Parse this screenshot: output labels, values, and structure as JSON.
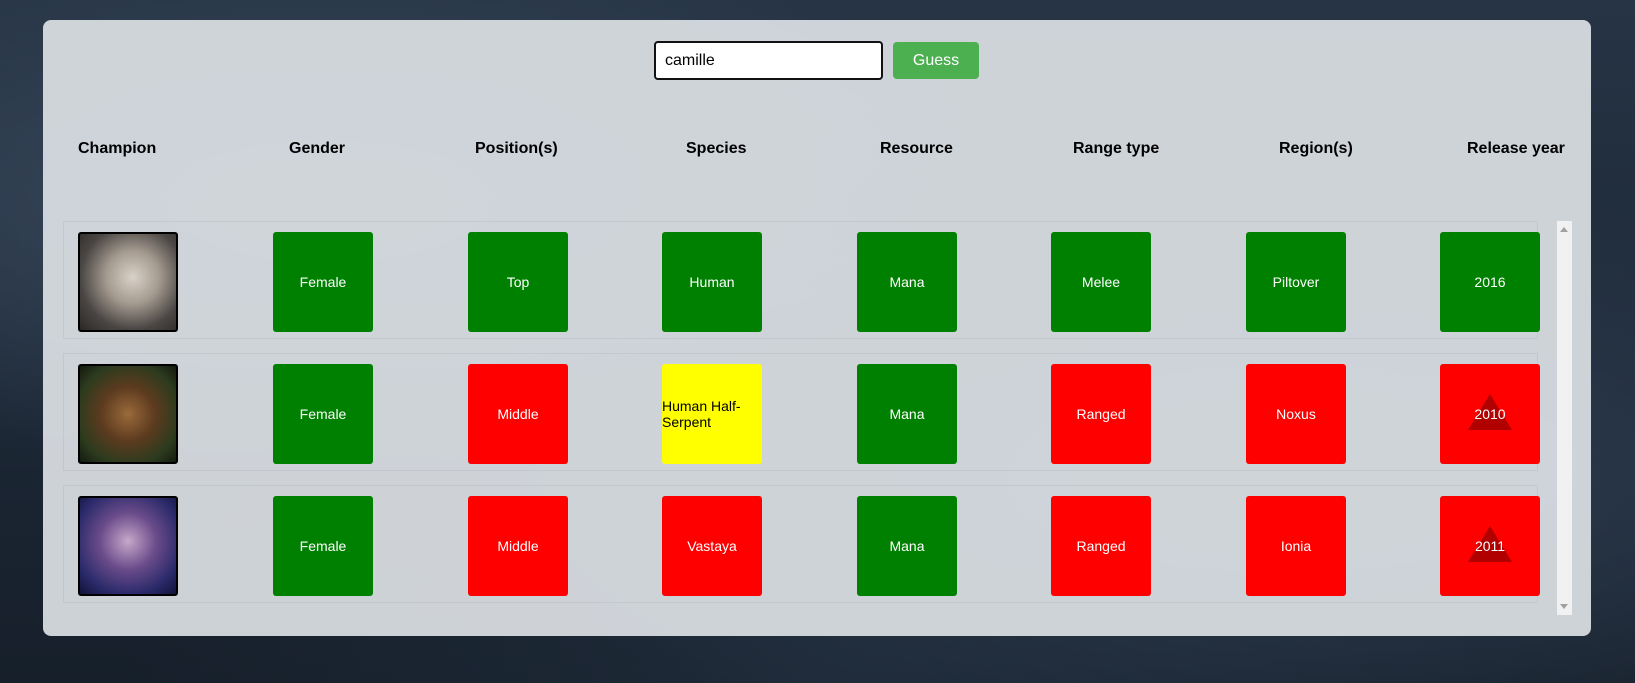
{
  "search": {
    "value": "camille",
    "button_label": "Guess"
  },
  "headers": [
    "Champion",
    "Gender",
    "Position(s)",
    "Species",
    "Resource",
    "Range type",
    "Region(s)",
    "Release year"
  ],
  "colors": {
    "correct": "#008000",
    "partial": "#ffff00",
    "wrong": "#ff0000",
    "arrow": "#b00000",
    "button": "#4caf50"
  },
  "rows": [
    {
      "avatar_icon": "champion-portrait-icon",
      "gender": {
        "text": "Female",
        "status": "correct"
      },
      "position": {
        "text": "Top",
        "status": "correct"
      },
      "species": {
        "text": "Human",
        "status": "correct"
      },
      "resource": {
        "text": "Mana",
        "status": "correct"
      },
      "range": {
        "text": "Melee",
        "status": "correct"
      },
      "region": {
        "text": "Piltover",
        "status": "correct"
      },
      "year": {
        "text": "2016",
        "status": "correct",
        "arrow": "none"
      }
    },
    {
      "avatar_icon": "champion-portrait-icon",
      "gender": {
        "text": "Female",
        "status": "correct"
      },
      "position": {
        "text": "Middle",
        "status": "wrong"
      },
      "species": {
        "text": "Human Half-Serpent",
        "status": "partial"
      },
      "resource": {
        "text": "Mana",
        "status": "correct"
      },
      "range": {
        "text": "Ranged",
        "status": "wrong"
      },
      "region": {
        "text": "Noxus",
        "status": "wrong"
      },
      "year": {
        "text": "2010",
        "status": "wrong",
        "arrow": "up"
      }
    },
    {
      "avatar_icon": "champion-portrait-icon",
      "gender": {
        "text": "Female",
        "status": "correct"
      },
      "position": {
        "text": "Middle",
        "status": "wrong"
      },
      "species": {
        "text": "Vastaya",
        "status": "wrong"
      },
      "resource": {
        "text": "Mana",
        "status": "correct"
      },
      "range": {
        "text": "Ranged",
        "status": "wrong"
      },
      "region": {
        "text": "Ionia",
        "status": "wrong"
      },
      "year": {
        "text": "2011",
        "status": "wrong",
        "arrow": "up"
      }
    }
  ]
}
